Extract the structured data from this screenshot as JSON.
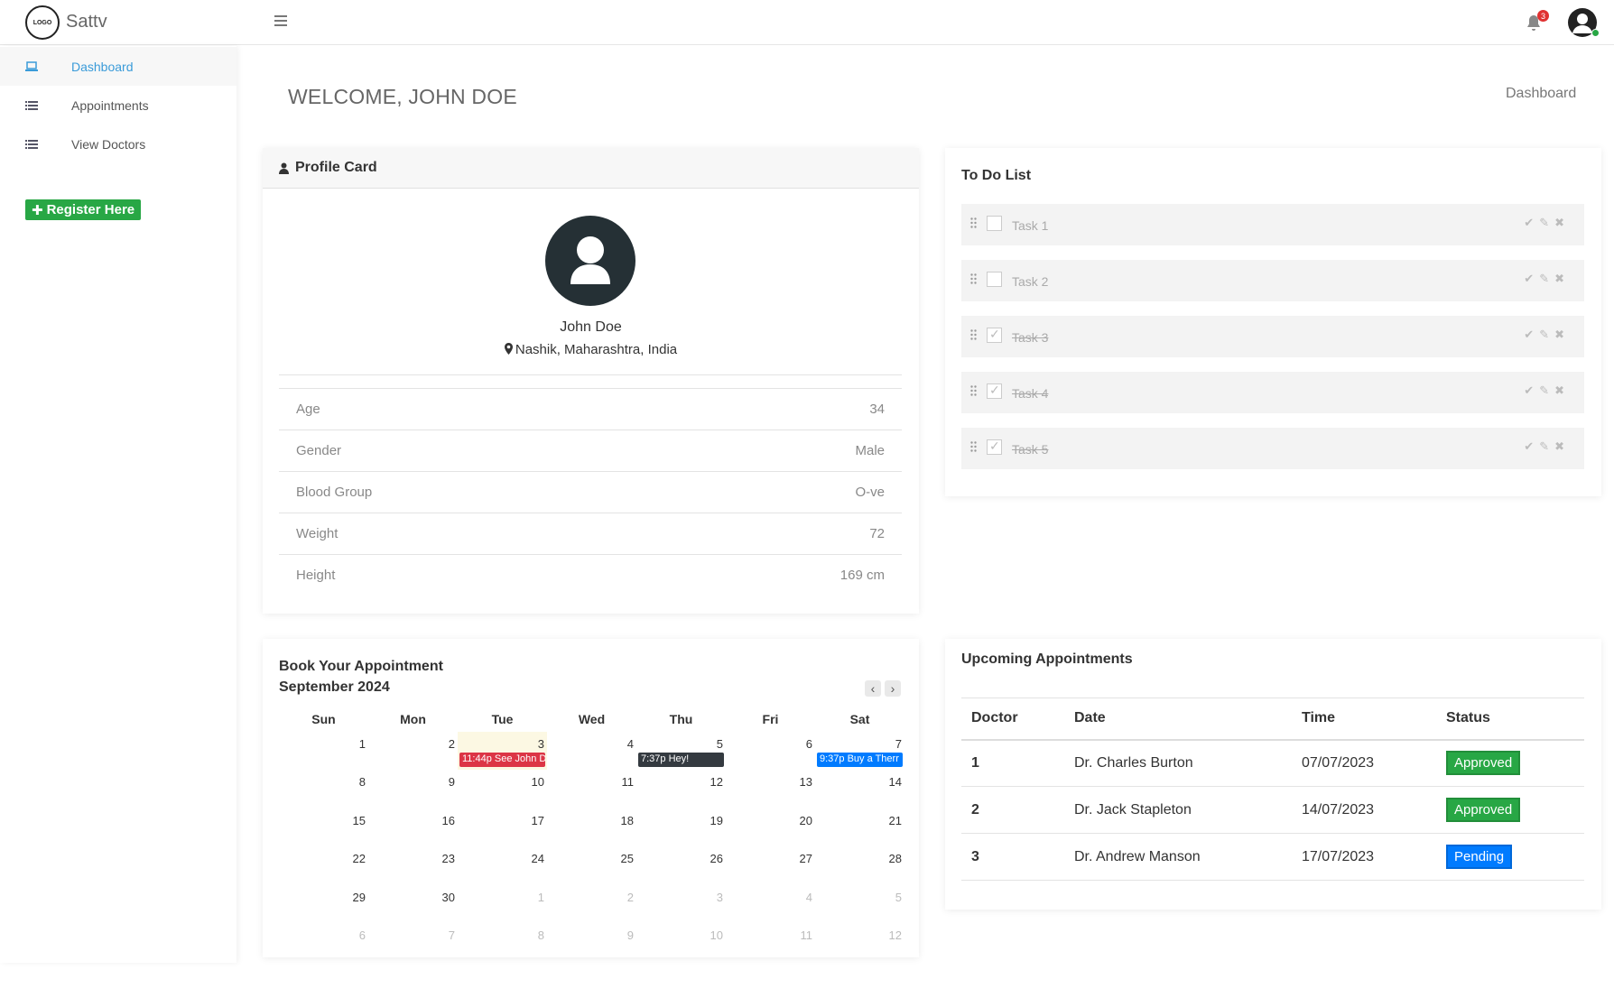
{
  "app": {
    "logo_text": "LOGO",
    "name": "Sattv",
    "notifications": "3"
  },
  "sidebar": {
    "items": [
      {
        "label": "Dashboard",
        "icon": "laptop-icon",
        "active": true
      },
      {
        "label": "Appointments",
        "icon": "list-icon",
        "active": false
      },
      {
        "label": "View Doctors",
        "icon": "list-icon",
        "active": false
      }
    ],
    "register_label": "Register Here"
  },
  "header": {
    "welcome": "WELCOME, JOHN DOE",
    "breadcrumb": "Dashboard"
  },
  "profile": {
    "title": "Profile Card",
    "name": "John Doe",
    "location": "Nashik, Maharashtra, India",
    "rows": [
      {
        "label": "Age",
        "value": "34"
      },
      {
        "label": "Gender",
        "value": "Male"
      },
      {
        "label": "Blood Group",
        "value": "O-ve"
      },
      {
        "label": "Weight",
        "value": "72"
      },
      {
        "label": "Height",
        "value": "169 cm"
      }
    ]
  },
  "todo": {
    "title": "To Do List",
    "tasks": [
      {
        "label": "Task 1",
        "done": false
      },
      {
        "label": "Task 2",
        "done": false
      },
      {
        "label": "Task 3",
        "done": true
      },
      {
        "label": "Task 4",
        "done": true
      },
      {
        "label": "Task 5",
        "done": true
      }
    ]
  },
  "calendar": {
    "title": "Book Your Appointment",
    "month": "September 2024",
    "days_of_week": [
      "Sun",
      "Mon",
      "Tue",
      "Wed",
      "Thu",
      "Fri",
      "Sat"
    ],
    "weeks": [
      [
        "1",
        "2",
        "3",
        "4",
        "5",
        "6",
        "7"
      ],
      [
        "8",
        "9",
        "10",
        "11",
        "12",
        "13",
        "14"
      ],
      [
        "15",
        "16",
        "17",
        "18",
        "19",
        "20",
        "21"
      ],
      [
        "22",
        "23",
        "24",
        "25",
        "26",
        "27",
        "28"
      ],
      [
        "29",
        "30",
        "1",
        "2",
        "3",
        "4",
        "5"
      ],
      [
        "6",
        "7",
        "8",
        "9",
        "10",
        "11",
        "12"
      ]
    ],
    "events": [
      {
        "time": "11:44p",
        "text": "See John D",
        "color": "#dc3545"
      },
      {
        "time": "7:37p",
        "text": "Hey!",
        "color": "#343a40"
      },
      {
        "time": "9:37p",
        "text": "Buy a Therr",
        "color": "#007bff"
      }
    ]
  },
  "appointments": {
    "title": "Upcoming Appointments",
    "columns": [
      "Doctor",
      "Date",
      "Time",
      "Status"
    ],
    "rows": [
      {
        "num": "1",
        "doctor": "Dr. Charles Burton",
        "date": "07/07/2023",
        "status": "Approved",
        "color": "#28a745"
      },
      {
        "num": "2",
        "doctor": "Dr. Jack Stapleton",
        "date": "14/07/2023",
        "status": "Approved",
        "color": "#28a745"
      },
      {
        "num": "3",
        "doctor": "Dr. Andrew Manson",
        "date": "17/07/2023",
        "status": "Pending",
        "color": "#007bff"
      }
    ]
  }
}
